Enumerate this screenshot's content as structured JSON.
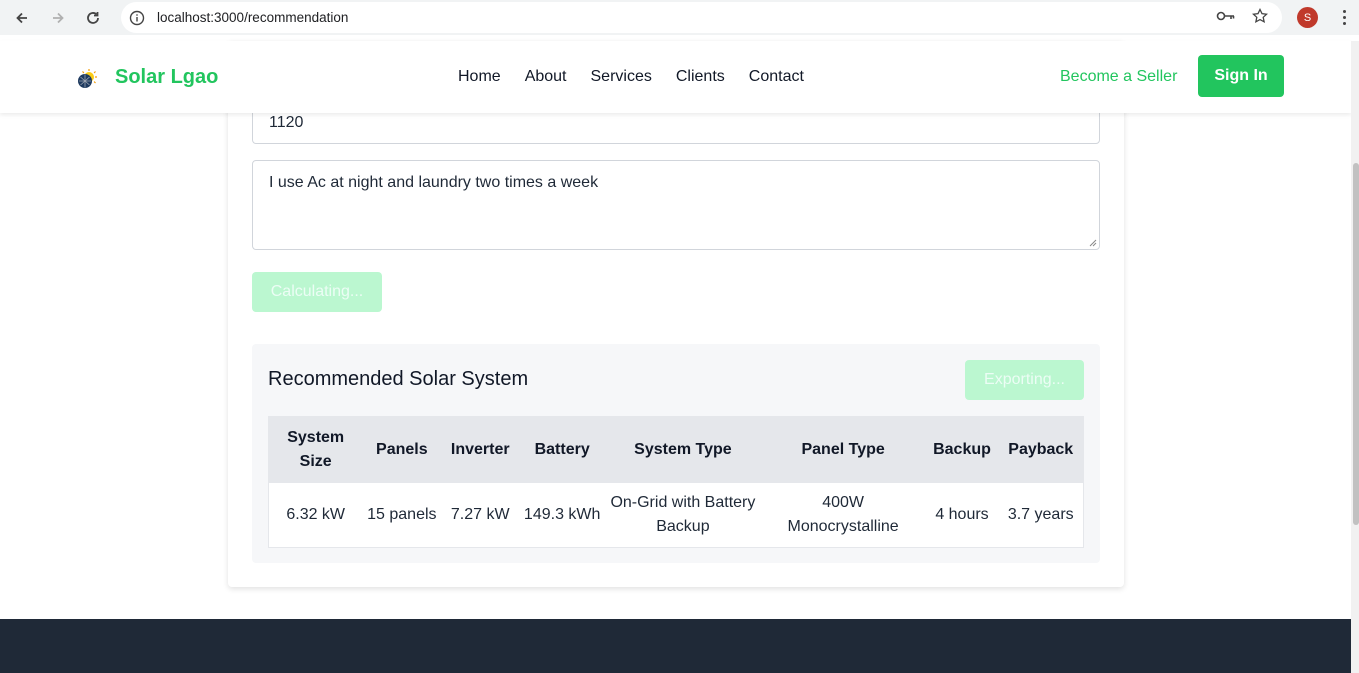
{
  "browser": {
    "url": "localhost:3000/recommendation",
    "profile_initial": "S"
  },
  "nav": {
    "brand": "Solar Lgao",
    "links": [
      "Home",
      "About",
      "Services",
      "Clients",
      "Contact"
    ],
    "become_seller": "Become a Seller",
    "sign_in": "Sign In"
  },
  "form": {
    "units_value": "1120",
    "usage_description": "I use Ac at night and laundry two times a week",
    "calculate_label": "Calculating..."
  },
  "recommendation": {
    "title": "Recommended Solar System",
    "export_label": "Exporting...",
    "headers": [
      "System Size",
      "Panels",
      "Inverter",
      "Battery",
      "System Type",
      "Panel Type",
      "Backup",
      "Payback"
    ],
    "row": [
      "6.32 kW",
      "15 panels",
      "7.27 kW",
      "149.3 kWh",
      "On-Grid with Battery Backup",
      "400W Monocrystalline",
      "4 hours",
      "3.7 years"
    ]
  },
  "colors": {
    "brand_green": "#22c55e",
    "disabled_green": "#bbf7d0",
    "footer": "#1f2937"
  }
}
